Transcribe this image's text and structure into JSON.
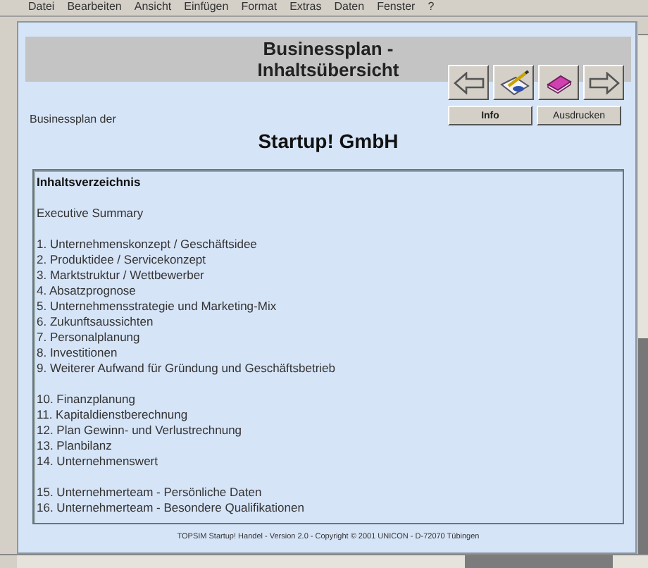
{
  "menu": [
    "Datei",
    "Bearbeiten",
    "Ansicht",
    "Einfügen",
    "Format",
    "Extras",
    "Daten",
    "Fenster",
    "?"
  ],
  "header": {
    "title_lines": [
      "Businessplan -",
      "Inhaltsübersicht"
    ]
  },
  "nav_buttons": [
    {
      "kind": "back"
    },
    {
      "kind": "notes"
    },
    {
      "kind": "book"
    },
    {
      "kind": "forward"
    }
  ],
  "buttons": [
    "Info",
    "Ausdrucken"
  ],
  "subtitle": "Businessplan der",
  "company": "Startup! GmbH",
  "toc": {
    "title": "Inhaltsverzeichnis",
    "groups": [
      {
        "items": [
          "Executive Summary"
        ]
      },
      {
        "items": [
          "1. Unternehmenskonzept / Geschäftsidee",
          "2. Produktidee / Servicekonzept",
          "3. Marktstruktur / Wettbewerber",
          "4. Absatzprognose",
          "5. Unternehmensstrategie und Marketing-Mix",
          "6. Zukunftsaussichten",
          "7. Personalplanung",
          "8. Investitionen",
          "9. Weiterer Aufwand für Gründung und Geschäftsbetrieb"
        ]
      },
      {
        "items": [
          "10. Finanzplanung",
          "11. Kapitaldienstberechnung",
          "12. Plan Gewinn- und Verlustrechnung",
          "13. Planbilanz",
          "14. Unternehmenswert"
        ]
      },
      {
        "items": [
          "15. Unternehmerteam - Persönliche Daten",
          "16. Unternehmerteam - Besondere Qualifikationen"
        ]
      }
    ]
  },
  "footer": "TOPSIM Startup! Handel - Version 2.0 - Copyright © 2001 UNICON - D-72070 Tübingen"
}
